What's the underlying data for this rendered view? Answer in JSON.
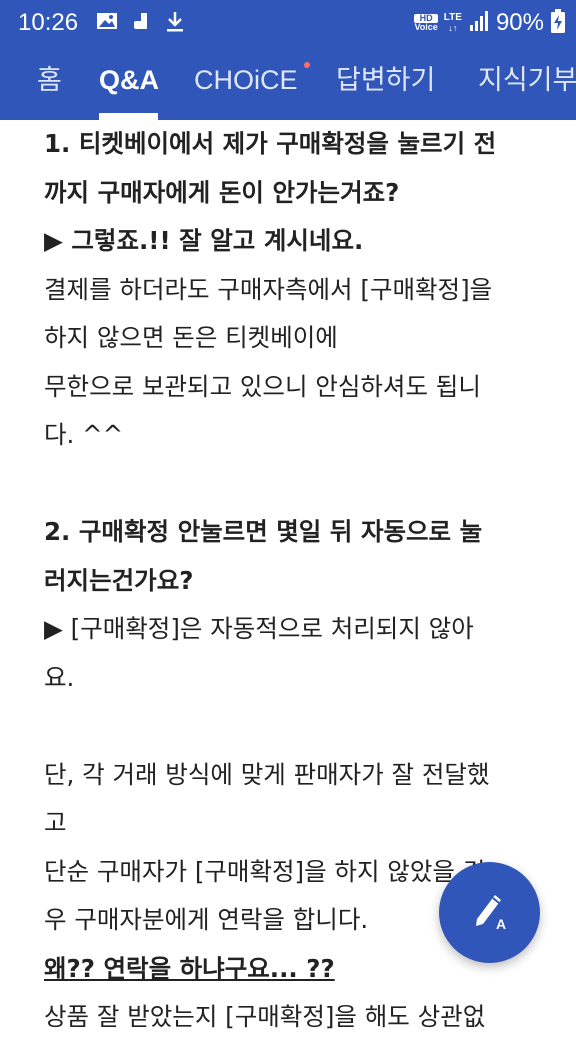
{
  "status_bar": {
    "time": "10:26",
    "hd_label": "HD",
    "voice_label": "Voice",
    "lte_label": "LTE",
    "battery_percent": "90%",
    "icons": [
      "image-icon",
      "notification-app-icon",
      "download-icon",
      "signal-icon",
      "battery-charging-icon"
    ]
  },
  "tabs": [
    {
      "label": "홈",
      "active": false
    },
    {
      "label": "Q&A",
      "active": true
    },
    {
      "label": "CHOiCE",
      "active": false,
      "new_dot": true
    },
    {
      "label": "답변하기",
      "active": false
    },
    {
      "label": "지식기부",
      "active": false
    }
  ],
  "content": {
    "lines": [
      "1. 티켓베이에서 제가 구매확정을 눌르기 전",
      "까지 구매자에게 돈이 안가는거죠?",
      "▶ 그렇죠.!! 잘 알고 계시네요.",
      "결제를 하더라도 구매자측에서 [구매확정]을",
      "하지 않으면 돈은 티켓베이에",
      "무한으로 보관되고 있으니 안심하셔도 됩니",
      "다. ^^",
      "",
      "2. 구매확정 안눌르면 몇일 뒤 자동으로 눌",
      "러지는건가요?",
      "▶ [구매확정]은 자동적으로 처리되지 않아",
      "요.",
      "",
      "단, 각 거래 방식에 맞게 판매자가 잘 전달했",
      "고",
      "단순 구매자가 [구매확정]을 하지 않았을 경",
      "우 구매자분에게 연락을 합니다.",
      "왜?? 연락을 하냐구요... ??",
      "상품  잘 받았는지 [구매확정]을 해도 상관없"
    ]
  },
  "fab": {
    "icon": "write-answer-icon"
  },
  "colors": {
    "primary": "#2f56b8",
    "text": "#222222",
    "new_dot": "#ff6b6b"
  }
}
